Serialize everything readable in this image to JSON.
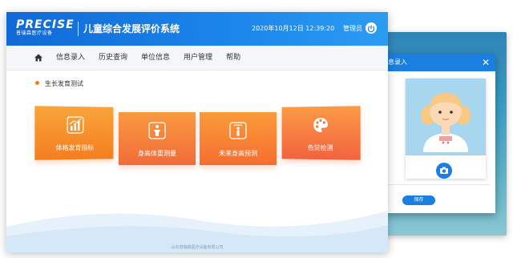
{
  "header": {
    "logo_main": "PRECISE",
    "logo_sub": "普瑞森医疗设备",
    "title": "儿童综合发展评价系统",
    "datetime": "2020年10月12日 12:39:20",
    "user": "管理员"
  },
  "nav": {
    "items": [
      "信息录入",
      "历史查询",
      "单位信息",
      "用户管理",
      "帮助"
    ]
  },
  "section_title": "生长发育测试",
  "cards": [
    {
      "label": "体格发育指标",
      "icon": "chart-icon"
    },
    {
      "label": "身高体重测量",
      "icon": "measure-icon"
    },
    {
      "label": "未来身高预测",
      "icon": "height-icon"
    },
    {
      "label": "色觉检测",
      "icon": "palette-icon"
    }
  ],
  "footer": "山东普瑞森医疗设备有限公司",
  "dialog": {
    "title": "息录入",
    "save_label": "保存"
  },
  "colors": {
    "header_blue": "#1b86ec",
    "card_orange": "#f7931e",
    "accent_dot": "#f27a1f"
  }
}
